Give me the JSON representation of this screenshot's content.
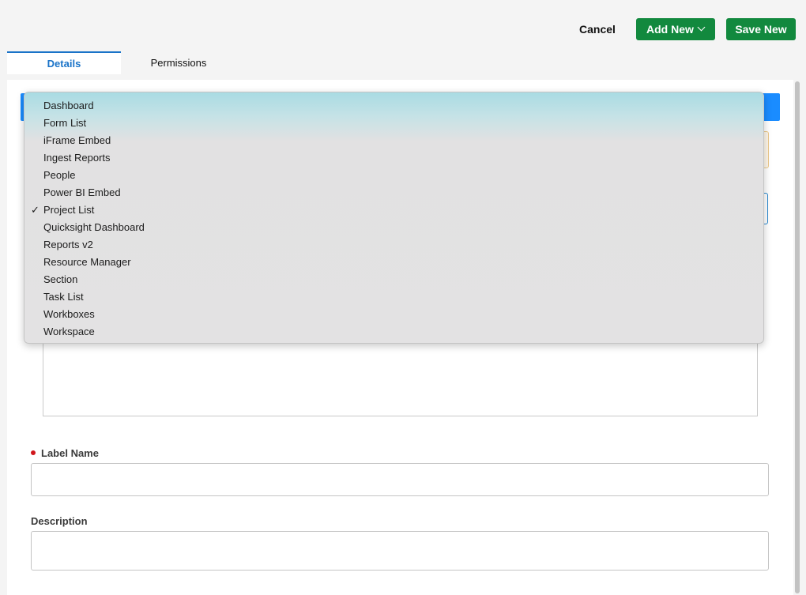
{
  "header": {
    "cancel_label": "Cancel",
    "add_new_label": "Add New",
    "save_new_label": "Save New"
  },
  "tabs": [
    {
      "label": "Details",
      "active": true
    },
    {
      "label": "Permissions",
      "active": false
    }
  ],
  "colors": {
    "accent": "#1a8cff",
    "primary_green": "#12893e",
    "required": "#d0161b"
  },
  "dropdown": {
    "selected": "Project List",
    "options": [
      "Dashboard",
      "Form List",
      "iFrame Embed",
      "Ingest Reports",
      "People",
      "Power BI Embed",
      "Project List",
      "Quicksight Dashboard",
      "Reports v2",
      "Resource Manager",
      "Section",
      "Task List",
      "Workboxes",
      "Workspace"
    ]
  },
  "form": {
    "label_name": {
      "label": "Label Name",
      "value": "",
      "required": true
    },
    "description": {
      "label": "Description",
      "value": ""
    }
  }
}
